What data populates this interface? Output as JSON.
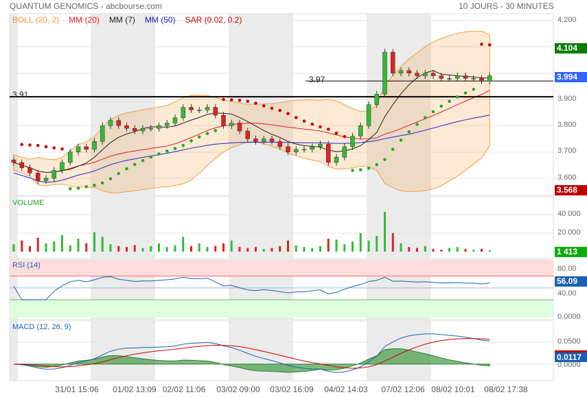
{
  "header": {
    "title": "QUANTUM GENOMICS - abcbourse.com",
    "period": "10 JOURS - 30 MINUTES"
  },
  "legend": {
    "boll": "BOLL (20, 2)",
    "mm20": "MM (20)",
    "mm7": "MM (7)",
    "mm50": "MM (50)",
    "sar": "SAR (0.02, 0.2)"
  },
  "colors": {
    "up": "#33bb33",
    "down": "#dd2222",
    "boll": "#f0a040",
    "mm20": "#e02020",
    "mm7": "#222222",
    "mm50": "#2222cc",
    "sar_up": "#22aa22",
    "sar_down": "#cc0000"
  },
  "panels": {
    "volume": "VOLUME",
    "rsi": "RSI (14)",
    "macd": "MACD (12, 26, 9)"
  },
  "levels": {
    "l1": "3.91",
    "l2": "3.97"
  },
  "axes": {
    "price": [
      "4.200",
      "3.900",
      "3.800",
      "3.700",
      "3.600"
    ],
    "volume": [
      "40 000",
      "20 000"
    ],
    "rsi": [
      "80.00",
      "40.00",
      "0.0000"
    ],
    "macd": [
      "0.0500",
      "0.0000"
    ]
  },
  "badges": {
    "high": "4.104",
    "last": "3.994",
    "low": "3.568",
    "volume": "1 413",
    "rsi": "56.09",
    "macd": "0.0117"
  },
  "xlabels": [
    "31/01 15:06",
    "01/02 13:09",
    "02/02 11:06",
    "03/02 09:00",
    "03/02 16:09",
    "04/02 14:03",
    "07/02 12:06",
    "08/02 10:01",
    "08/02 17:38"
  ],
  "chart_data": {
    "type": "candlestick",
    "closes": [
      3.66,
      3.64,
      3.62,
      3.59,
      3.6,
      3.63,
      3.66,
      3.7,
      3.72,
      3.71,
      3.74,
      3.8,
      3.82,
      3.8,
      3.79,
      3.78,
      3.79,
      3.79,
      3.8,
      3.81,
      3.83,
      3.87,
      3.86,
      3.86,
      3.87,
      3.84,
      3.8,
      3.81,
      3.78,
      3.75,
      3.74,
      3.75,
      3.74,
      3.72,
      3.7,
      3.71,
      3.71,
      3.72,
      3.73,
      3.66,
      3.68,
      3.72,
      3.76,
      3.8,
      3.88,
      3.92,
      4.08,
      4.0,
      4.01,
      4.0,
      3.99,
      4.0,
      3.99,
      3.98,
      3.98,
      3.99,
      3.98,
      3.98,
      3.97,
      3.99
    ],
    "volumes": [
      8000,
      12000,
      6000,
      15000,
      9000,
      11000,
      18000,
      7000,
      14000,
      9000,
      21000,
      16000,
      8000,
      6000,
      5000,
      7000,
      4000,
      6000,
      9000,
      5000,
      7000,
      16000,
      6000,
      9000,
      5000,
      6000,
      9000,
      12000,
      5000,
      4000,
      5000,
      3000,
      4000,
      6000,
      12000,
      7000,
      5000,
      4000,
      6000,
      14000,
      13000,
      8000,
      11000,
      20000,
      12000,
      17000,
      43000,
      20000,
      9000,
      5000,
      4000,
      6000,
      3000,
      2000,
      4000,
      5000,
      3000,
      2000,
      3000,
      1413
    ],
    "ylim": [
      3.55,
      4.22
    ]
  }
}
